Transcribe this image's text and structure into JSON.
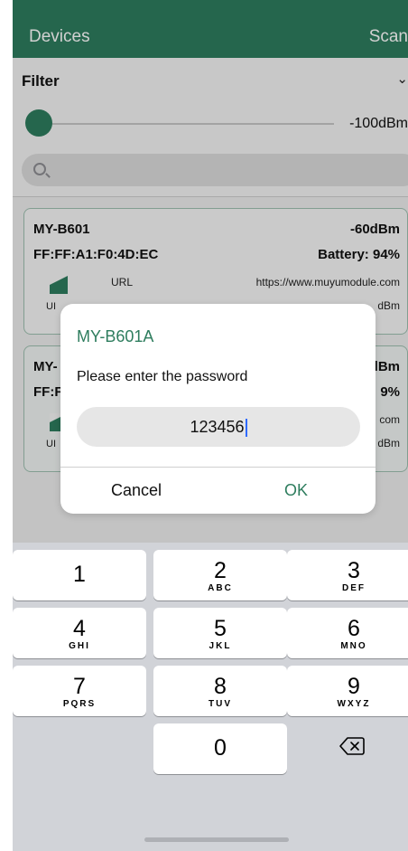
{
  "header": {
    "title": "Devices",
    "scan_label": "Scan"
  },
  "filter": {
    "label": "Filter",
    "rssi_value": "-100dBm",
    "search_placeholder": ""
  },
  "devices": [
    {
      "name": "MY-B601",
      "rssi": "-60dBm",
      "mac": "FF:FF:A1:F0:4D:EC",
      "battery": "Battery: 94%",
      "url_label": "URL",
      "url_value": "https://www.muyumodule.com",
      "small_left": "UI",
      "small_right": "dBm"
    },
    {
      "name": "MY-",
      "rssi": "lBm",
      "mac": "FF:F",
      "battery": "9%",
      "url_value": "com",
      "small_left": "UI",
      "small_right": "dBm"
    }
  ],
  "dialog": {
    "title": "MY-B601A",
    "message": "Please enter the password",
    "password": "123456",
    "cancel_label": "Cancel",
    "ok_label": "OK"
  },
  "keypad": {
    "keys": [
      {
        "num": "1",
        "letters": ""
      },
      {
        "num": "2",
        "letters": "ABC"
      },
      {
        "num": "3",
        "letters": "DEF"
      },
      {
        "num": "4",
        "letters": "GHI"
      },
      {
        "num": "5",
        "letters": "JKL"
      },
      {
        "num": "6",
        "letters": "MNO"
      },
      {
        "num": "7",
        "letters": "PQRS"
      },
      {
        "num": "8",
        "letters": "TUV"
      },
      {
        "num": "9",
        "letters": "WXYZ"
      },
      {
        "num": "0",
        "letters": ""
      }
    ],
    "delete_icon": "backspace-icon"
  },
  "colors": {
    "accent": "#2e7d5e",
    "caret": "#2f6bff"
  }
}
